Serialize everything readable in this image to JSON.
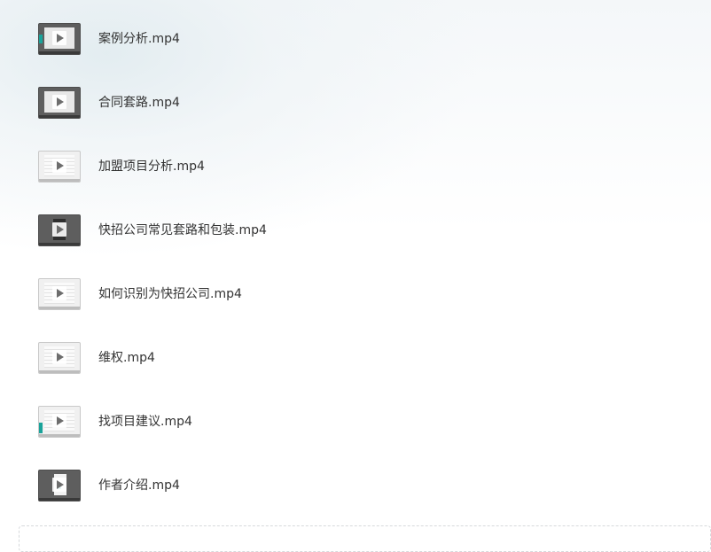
{
  "files": [
    {
      "name": "案例分析.mp4",
      "thumb_style": "dark",
      "icon": "video-thumbnail-icon"
    },
    {
      "name": "合同套路.mp4",
      "thumb_style": "dark",
      "icon": "video-thumbnail-icon"
    },
    {
      "name": "加盟项目分析.mp4",
      "thumb_style": "light",
      "icon": "video-thumbnail-icon"
    },
    {
      "name": "快招公司常见套路和包装.mp4",
      "thumb_style": "dark",
      "icon": "video-thumbnail-icon"
    },
    {
      "name": "如何识别为快招公司.mp4",
      "thumb_style": "light",
      "icon": "video-thumbnail-icon"
    },
    {
      "name": "维权.mp4",
      "thumb_style": "light",
      "icon": "video-thumbnail-icon"
    },
    {
      "name": "找项目建议.mp4",
      "thumb_style": "light",
      "icon": "video-thumbnail-icon"
    },
    {
      "name": "作者介绍.mp4",
      "thumb_style": "dark",
      "icon": "video-thumbnail-icon"
    }
  ],
  "colors": {
    "text": "#333333",
    "accent_teal": "#1aa39a",
    "dashed_border": "#d6d9dc"
  }
}
